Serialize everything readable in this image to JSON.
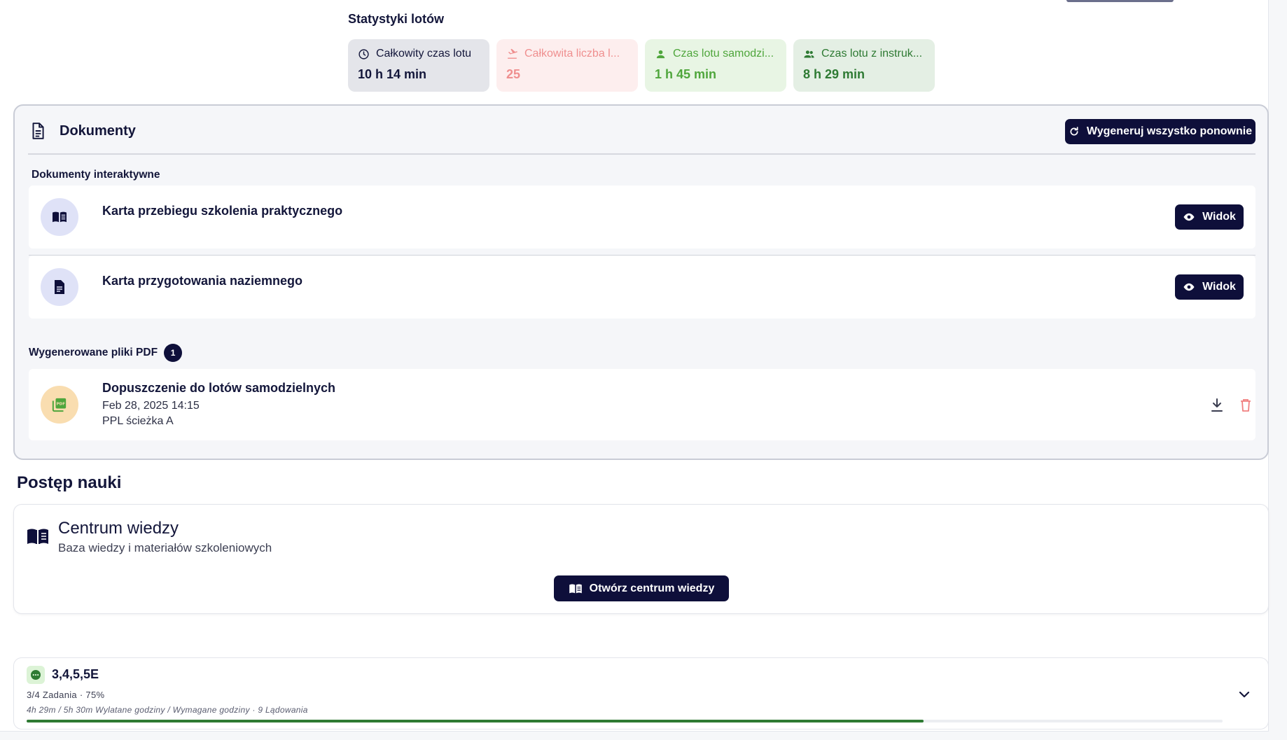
{
  "stats": {
    "title": "Statystyki lotów",
    "cards": [
      {
        "label": "Całkowity czas lotu",
        "value": "10 h 14 min",
        "icon": "clock-icon"
      },
      {
        "label": "Całkowita liczba l...",
        "value": "25",
        "icon": "landing-icon"
      },
      {
        "label": "Czas lotu samodzi...",
        "value": "1 h 45 min",
        "icon": "person-icon"
      },
      {
        "label": "Czas lotu z instruk...",
        "value": "8 h 29 min",
        "icon": "group-icon"
      }
    ]
  },
  "documents": {
    "title": "Dokumenty",
    "regenerate_label": "Wygeneruj wszystko ponownie",
    "interactive_label": "Dokumenty interaktywne",
    "interactive": [
      {
        "title": "Karta przebiegu szkolenia praktycznego",
        "button": "Widok",
        "icon": "book-icon"
      },
      {
        "title": "Karta przygotowania naziemnego",
        "button": "Widok",
        "icon": "document-icon"
      }
    ],
    "pdf_label": "Wygenerowane pliki PDF",
    "pdf_count": "1",
    "pdfs": [
      {
        "title": "Dopuszczenie do lotów samodzielnych",
        "date": "Feb 28, 2025 14:15",
        "path": "PPL ścieżka A",
        "icon": "pdf-icon"
      }
    ]
  },
  "learning": {
    "title": "Postęp nauki",
    "kb_title": "Centrum wiedzy",
    "kb_subtitle": "Baza wiedzy i materiałów szkoleniowych",
    "kb_button": "Otwórz centrum wiedzy"
  },
  "task": {
    "title": "3,4,5,5E",
    "progress_text": "3/4 Zadania · 75%",
    "hours_text": "4h 29m / 5h 30m Wylatane godziny / Wymagane godziny · 9 Lądowania",
    "progress_fraction": 0.75
  },
  "colors": {
    "primary": "#0e0f3a",
    "landing": "#ef8f8f",
    "solo": "#4fa63c",
    "instructor": "#2e7a33",
    "delete": "#f08080"
  }
}
